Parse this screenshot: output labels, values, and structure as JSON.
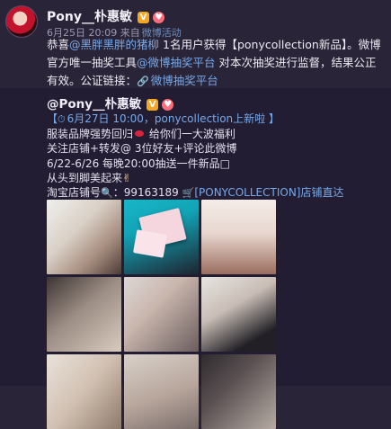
{
  "post": {
    "author": "Pony__朴惠敏",
    "date": "6月25日 20:09",
    "from_prefix": "来自",
    "source": "微博活动",
    "body": {
      "p1_a": "恭喜",
      "mention1": "@黑胖黑胖的猪柳",
      "p1_b": " 1名用户获得【ponycollection新品】。微博官方唯一抽奖工具",
      "mention2": "@微博抽奖平台",
      "p1_c": " 对本次抽奖进行监督，结果公正有效。公证链接：",
      "link_label": "微博抽奖平台"
    }
  },
  "repost": {
    "author": "@Pony__朴惠敏",
    "line1_a": "【",
    "line1_b": "6月27日 10:00，ponycollection上新啦",
    "line1_c": " 】",
    "line2_a": "服装品牌强势回归",
    "line2_b": " 给你们一大波福利",
    "line3": "关注店铺+转发@ 3位好友+评论此微博",
    "line4": "6/22-6/26 每晚20:00抽送一件新品□",
    "line5": "从头到脚美起来",
    "line6_a": "淘宝店铺号",
    "line6_b": "：99163189",
    "line6_link": "[PONYCOLLECTION]店铺直达"
  },
  "photos": [
    "photo-1",
    "photo-2",
    "photo-3",
    "photo-4",
    "photo-5",
    "photo-6",
    "photo-7",
    "photo-8",
    "photo-9"
  ],
  "icons": {
    "verified": "verified-v-icon",
    "fan": "heart-badge-icon",
    "link": "link-icon",
    "clock": "clock-icon",
    "lips": "lips-icon",
    "victory": "victory-hand-icon",
    "search": "magnifier-icon",
    "cart": "cart-icon"
  },
  "colors": {
    "background": "#2a2438",
    "repost_background": "#231d33",
    "link": "#76a9ea",
    "meta": "#9f96b4"
  }
}
